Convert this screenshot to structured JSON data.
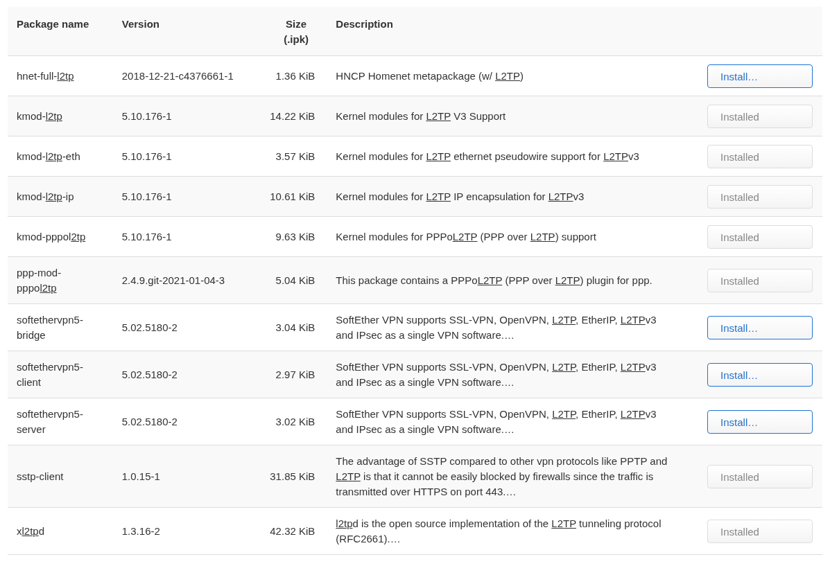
{
  "table": {
    "columns": [
      "Package name",
      "Version",
      "Size (.ipk)",
      "Description"
    ],
    "rows": [
      {
        "name": [
          "hnet-full-",
          {
            "underlined": "l2tp"
          }
        ],
        "version": "2018-12-21-c4376661-1",
        "size": "1.36 KiB",
        "description": [
          "HNCP Homenet metapackage (w/ ",
          {
            "underlined": "L2TP"
          },
          ")"
        ],
        "action": {
          "label": "Install…",
          "installed": false
        }
      },
      {
        "name": [
          "kmod-",
          {
            "underlined": "l2tp"
          }
        ],
        "version": "5.10.176-1",
        "size": "14.22 KiB",
        "description": [
          "Kernel modules for ",
          {
            "underlined": "L2TP"
          },
          " V3 Support"
        ],
        "action": {
          "label": "Installed",
          "installed": true
        }
      },
      {
        "name": [
          "kmod-",
          {
            "underlined": "l2tp"
          },
          "-eth"
        ],
        "version": "5.10.176-1",
        "size": "3.57 KiB",
        "description": [
          "Kernel modules for ",
          {
            "underlined": "L2TP"
          },
          " ethernet pseudowire support for ",
          {
            "underlined": "L2TP"
          },
          "v3"
        ],
        "action": {
          "label": "Installed",
          "installed": true
        }
      },
      {
        "name": [
          "kmod-",
          {
            "underlined": "l2tp"
          },
          "-ip"
        ],
        "version": "5.10.176-1",
        "size": "10.61 KiB",
        "description": [
          "Kernel modules for ",
          {
            "underlined": "L2TP"
          },
          " IP encapsulation for ",
          {
            "underlined": "L2TP"
          },
          "v3"
        ],
        "action": {
          "label": "Installed",
          "installed": true
        }
      },
      {
        "name": [
          "kmod-pppol",
          {
            "underlined": "2tp"
          }
        ],
        "version": "5.10.176-1",
        "size": "9.63 KiB",
        "description": [
          "Kernel modules for PPPo",
          {
            "underlined": "L2TP"
          },
          " (PPP over ",
          {
            "underlined": "L2TP"
          },
          ") support"
        ],
        "action": {
          "label": "Installed",
          "installed": true
        }
      },
      {
        "name": [
          "ppp-mod-pppo",
          {
            "underlined": "l2tp"
          }
        ],
        "version": "2.4.9.git-2021-01-04-3",
        "size": "5.04 KiB",
        "description": [
          "This package contains a PPPo",
          {
            "underlined": "L2TP"
          },
          " (PPP over ",
          {
            "underlined": "L2TP"
          },
          ") plugin for ppp."
        ],
        "action": {
          "label": "Installed",
          "installed": true
        }
      },
      {
        "name": [
          "softethervpn5-bridge"
        ],
        "version": "5.02.5180-2",
        "size": "3.04 KiB",
        "description": [
          "SoftEther VPN supports SSL-VPN, OpenVPN, ",
          {
            "underlined": "L2TP"
          },
          ", EtherIP, ",
          {
            "underlined": "L2TP"
          },
          "v3 and IPsec as a single VPN software.…"
        ],
        "action": {
          "label": "Install…",
          "installed": false
        }
      },
      {
        "name": [
          "softethervpn5-client"
        ],
        "version": "5.02.5180-2",
        "size": "2.97 KiB",
        "description": [
          "SoftEther VPN supports SSL-VPN, OpenVPN, ",
          {
            "underlined": "L2TP"
          },
          ", EtherIP, ",
          {
            "underlined": "L2TP"
          },
          "v3 and IPsec as a single VPN software.…"
        ],
        "action": {
          "label": "Install…",
          "installed": false
        }
      },
      {
        "name": [
          "softethervpn5-server"
        ],
        "version": "5.02.5180-2",
        "size": "3.02 KiB",
        "description": [
          "SoftEther VPN supports SSL-VPN, OpenVPN, ",
          {
            "underlined": "L2TP"
          },
          ", EtherIP, ",
          {
            "underlined": "L2TP"
          },
          "v3 and IPsec as a single VPN software.…"
        ],
        "action": {
          "label": "Install…",
          "installed": false
        }
      },
      {
        "name": [
          "sstp-client"
        ],
        "version": "1.0.15-1",
        "size": "31.85 KiB",
        "description": [
          "The advantage of SSTP compared to other vpn protocols like PPTP and ",
          {
            "underlined": "L2TP"
          },
          " is that it cannot be easily blocked by firewalls since the traffic is transmitted over HTTPS on port 443.…"
        ],
        "action": {
          "label": "Installed",
          "installed": true
        }
      },
      {
        "name": [
          "x",
          {
            "underlined": "l2tp"
          },
          "d"
        ],
        "version": "1.3.16-2",
        "size": "42.32 KiB",
        "description": [
          {
            "underlined": "l2tp"
          },
          "d is the open source implementation of the ",
          {
            "underlined": "L2TP"
          },
          " tunneling protocol (RFC2661).…"
        ],
        "action": {
          "label": "Installed",
          "installed": true
        }
      }
    ]
  }
}
